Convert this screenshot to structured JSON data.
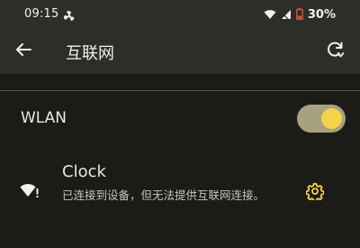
{
  "status_bar": {
    "time": "09:15",
    "battery_percent": "30%",
    "icons": [
      "fan-icon",
      "wifi-icon",
      "signal-icon",
      "battery-low-icon"
    ]
  },
  "app_bar": {
    "title": "互联网",
    "back_icon": "arrow-back-icon",
    "refresh_icon": "refresh-icon"
  },
  "wlan": {
    "label": "WLAN",
    "enabled": true
  },
  "networks": [
    {
      "name": "Clock",
      "status": "已连接到设备，但无法提供互联网连接。",
      "icon": "wifi-warning-icon",
      "settings_icon": "gear-icon"
    }
  ],
  "colors": {
    "background": "#1b1c18",
    "bar": "#2d2e29",
    "toggle_track": "#a6a27e",
    "toggle_knob": "#f3d34a",
    "accent": "#f3d34a",
    "battery_warning": "#e0503c"
  }
}
